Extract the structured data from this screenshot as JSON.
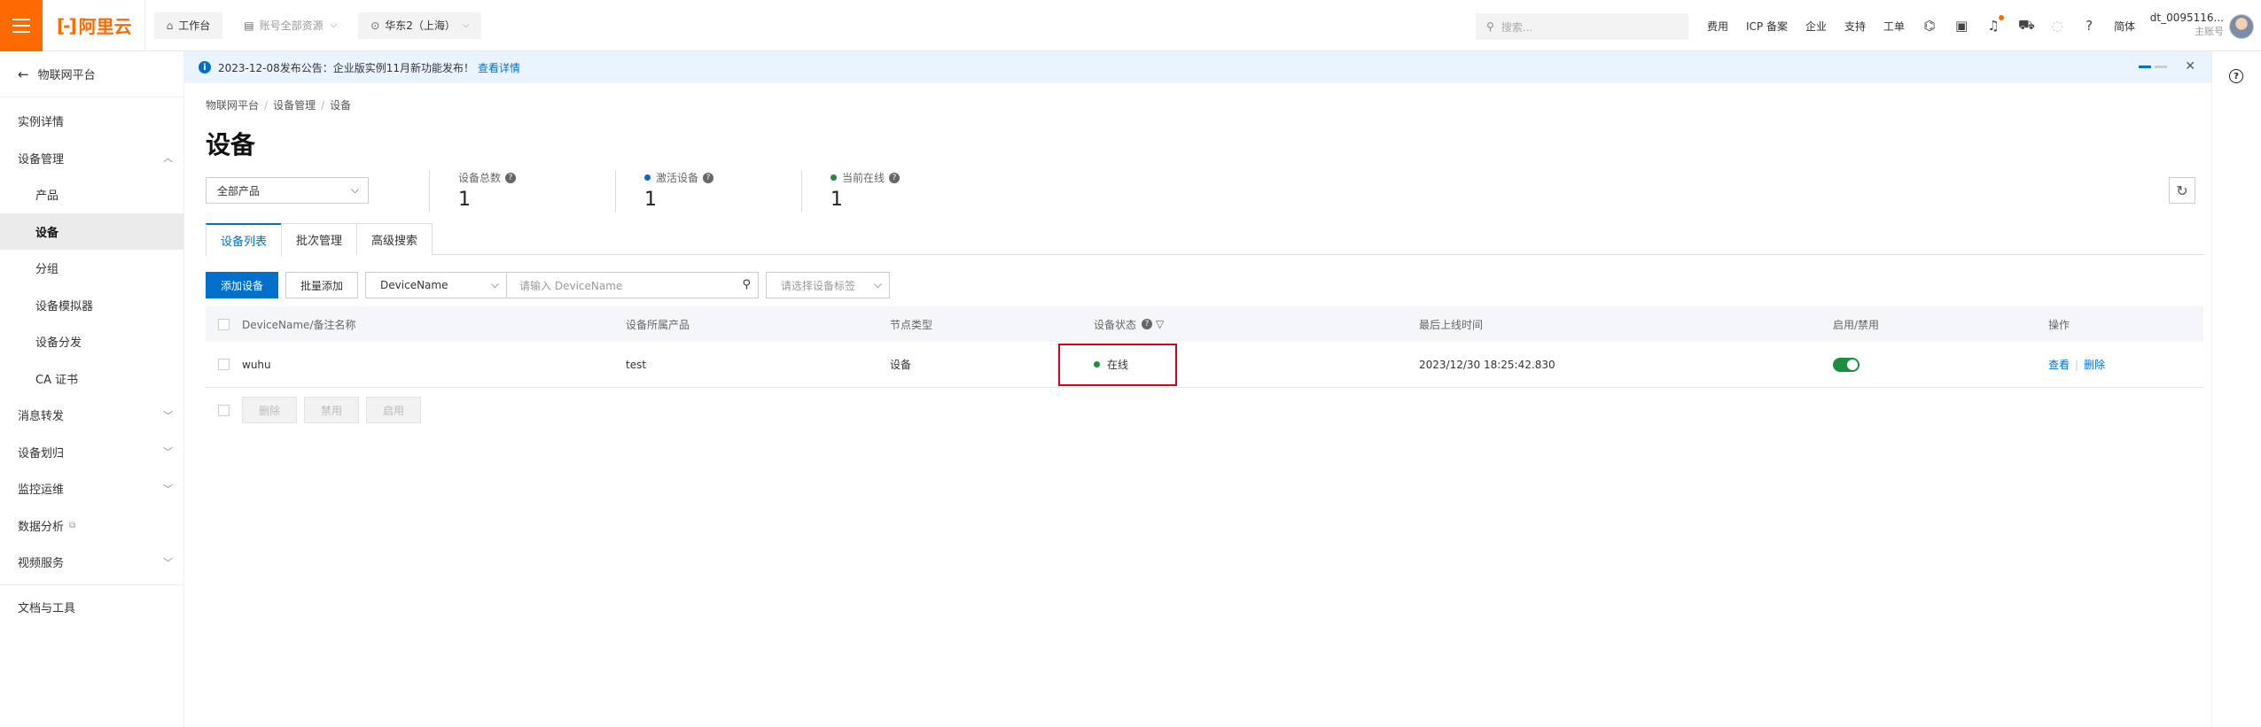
{
  "topbar": {
    "logo": "阿里云",
    "workbench": "工作台",
    "resource_scope": "账号全部资源",
    "region": "华东2（上海）",
    "search_placeholder": "搜索...",
    "links": [
      "费用",
      "ICP 备案",
      "企业",
      "支持",
      "工单"
    ],
    "lang": "简体",
    "user_name": "dt_0095116...",
    "user_role": "主账号"
  },
  "sidebar": {
    "back_label": "物联网平台",
    "items": [
      {
        "label": "实例详情"
      },
      {
        "label": "设备管理"
      },
      {
        "label": "产品"
      },
      {
        "label": "设备"
      },
      {
        "label": "分组"
      },
      {
        "label": "设备模拟器"
      },
      {
        "label": "设备分发"
      },
      {
        "label": "CA 证书"
      },
      {
        "label": "消息转发"
      },
      {
        "label": "设备划归"
      },
      {
        "label": "监控运维"
      },
      {
        "label": "数据分析"
      },
      {
        "label": "视频服务"
      },
      {
        "label": "文档与工具"
      }
    ]
  },
  "notice": {
    "text": "2023-12-08发布公告：企业版实例11月新功能发布！",
    "link": "查看详情"
  },
  "breadcrumb": [
    "物联网平台",
    "设备管理",
    "设备"
  ],
  "page_title": "设备",
  "product_filter": "全部产品",
  "stats": [
    {
      "label": "设备总数",
      "value": "1"
    },
    {
      "label": "激活设备",
      "value": "1",
      "dot_color": "#0070cc"
    },
    {
      "label": "当前在线",
      "value": "1",
      "dot_color": "#1e8e3e"
    }
  ],
  "tabs": [
    "设备列表",
    "批次管理",
    "高级搜索"
  ],
  "toolbar": {
    "add_device": "添加设备",
    "batch_add": "批量添加",
    "field": "DeviceName",
    "search_placeholder": "请输入 DeviceName",
    "tag_placeholder": "请选择设备标签"
  },
  "table": {
    "headers": [
      "DeviceName/备注名称",
      "设备所属产品",
      "节点类型",
      "设备状态",
      "最后上线时间",
      "启用/禁用",
      "操作"
    ],
    "rows": [
      {
        "name": "wuhu",
        "product": "test",
        "node_type": "设备",
        "status": "在线",
        "last_online": "2023/12/30 18:25:42.830",
        "enabled": true,
        "ops": [
          "查看",
          "删除"
        ]
      }
    ]
  },
  "bulk_actions": [
    "删除",
    "禁用",
    "启用"
  ],
  "colors": {
    "accent": "#0070cc",
    "brand": "#ff6a00",
    "online": "#1e8e3e",
    "highlight": "#d9001b"
  }
}
